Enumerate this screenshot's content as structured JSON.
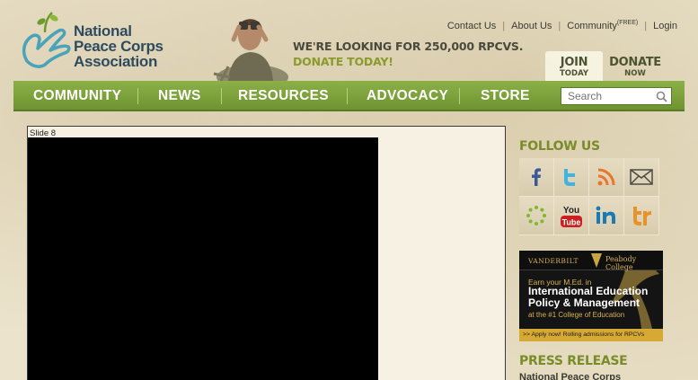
{
  "header": {
    "logo_lines": [
      "National",
      "Peace Corps",
      "Association"
    ],
    "tagline_line1": "WE'RE LOOKING FOR 250,000 RPCVS.",
    "tagline_line2": "DONATE TODAY!",
    "top_links": {
      "contact": "Contact Us",
      "about": "About Us",
      "community": "Community",
      "community_badge": "(FREE)",
      "login": "Login"
    },
    "join": {
      "big": "JOIN",
      "small": "TODAY"
    },
    "donate": {
      "big": "DONATE",
      "small": "NOW"
    }
  },
  "nav": {
    "items": [
      "COMMUNITY",
      "NEWS",
      "RESOURCES",
      "ADVOCACY",
      "STORE"
    ],
    "search_placeholder": "Search"
  },
  "slider": {
    "label": "Slide 8"
  },
  "sidebar": {
    "follow_title": "FOLLOW US",
    "social_icons": [
      "facebook-icon",
      "twitter-icon",
      "rss-icon",
      "email-icon",
      "ning-icon",
      "youtube-icon",
      "linkedin-icon",
      "technorati-icon"
    ],
    "ad": {
      "vanderbilt": "VANDERBILT",
      "peabody": "Peabody College",
      "earn": "Earn your M.Ed. in",
      "main_line1": "International Education",
      "main_line2": "Policy & Management",
      "sub": "at the #1 College of Education",
      "bottom": ">> Apply now! Rolling admissions for RPCVs"
    },
    "press_title": "PRESS RELEASE",
    "press_item": "National Peace Corps"
  },
  "colors": {
    "nav_green": "#7fa33c",
    "title_olive": "#7a8c2a",
    "logo_blue": "#2e4b5e"
  }
}
